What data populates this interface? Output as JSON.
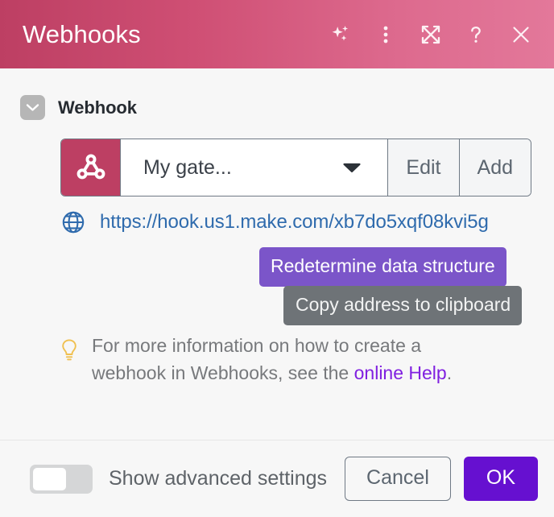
{
  "titlebar": {
    "title": "Webhooks",
    "icons": [
      {
        "name": "sparkles-icon",
        "label": "AI assistant"
      },
      {
        "name": "more-vertical-icon",
        "label": "More options"
      },
      {
        "name": "expand-icon",
        "label": "Expand"
      },
      {
        "name": "help-icon",
        "label": "Help"
      },
      {
        "name": "close-icon",
        "label": "Close"
      }
    ],
    "colors": {
      "gradient_start": "#bd3f63",
      "gradient_end": "#e3789a"
    }
  },
  "section": {
    "title": "Webhook",
    "collapse_icon": "chevron-down-icon"
  },
  "webhook_select": {
    "badge_icon": "webhook-icon",
    "badge_color": "#bd3f63",
    "value": "My gate...",
    "caret_icon": "chevron-down-icon",
    "edit_label": "Edit",
    "add_label": "Add"
  },
  "url": {
    "icon": "globe-icon",
    "text": "https://hook.us1.make.com/xb7do5xqf08kvi5g",
    "color": "#2f6bad"
  },
  "actions": {
    "redetermine_label": "Redetermine data structure",
    "redetermine_color": "#7b55c9",
    "tooltip_label": "Copy address to clipboard",
    "tooltip_color": "#6e7377"
  },
  "hint": {
    "icon": "lightbulb-icon",
    "text_before": "For more information on how to create a webhook in Webhooks, see the ",
    "link_label": "online Help",
    "text_after": "."
  },
  "footer": {
    "toggle_name": "show-advanced-settings-toggle",
    "toggle_state": "off",
    "toggle_label": "Show advanced settings",
    "cancel_label": "Cancel",
    "ok_label": "OK",
    "ok_color": "#6610d0"
  }
}
